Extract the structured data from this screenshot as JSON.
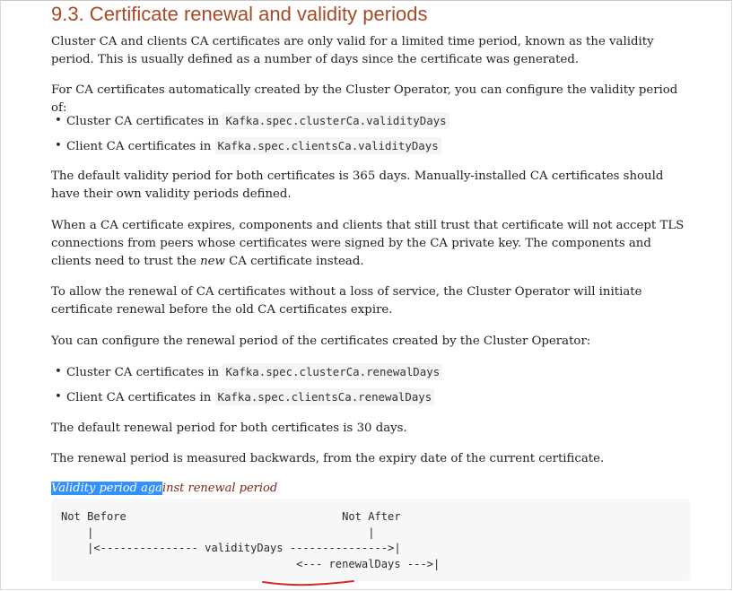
{
  "section": {
    "heading": "9.3. Certificate renewal and validity periods",
    "intro": "Cluster CA and clients CA certificates are only valid for a limited time period, known as the validity period. This is usually defined as a number of days since the certificate was generated.",
    "auto_created": "For CA certificates automatically created by the Cluster Operator, you can configure the validity period of:",
    "validity_items": [
      {
        "text": "Cluster CA certificates in ",
        "code": "Kafka.spec.clusterCa.validityDays"
      },
      {
        "text": "Client CA certificates in ",
        "code": "Kafka.spec.clientsCa.validityDays"
      }
    ],
    "default_validity": "The default validity period for both certificates is 365 days. Manually-installed CA certificates should have their own validity periods defined.",
    "expiry_part1": "When a CA certificate expires, components and clients that still trust that certificate will not accept TLS connections from peers whose certificates were signed by the CA private key. The components and clients need to trust the ",
    "expiry_emph": "new",
    "expiry_part2": " CA certificate instead.",
    "renewal_service": "To allow the renewal of CA certificates without a loss of service, the Cluster Operator will initiate certificate renewal before the old CA certificates expire.",
    "renewal_configure": "You can configure the renewal period of the certificates created by the Cluster Operator:",
    "renewal_items": [
      {
        "text": "Cluster CA certificates in ",
        "code": "Kafka.spec.clusterCa.renewalDays"
      },
      {
        "text": "Client CA certificates in ",
        "code": "Kafka.spec.clientsCa.renewalDays"
      }
    ],
    "default_renewal": "The default renewal period for both certificates is 30 days.",
    "measured": "The renewal period is measured backwards, from the expiry date of the current certificate.",
    "caption_selected": "Validity period aga",
    "caption_rest": "inst renewal period",
    "listing": "Not Before                                 Not After\n    |                                          |\n    |<--------------- validityDays --------------->|\n                                    <--- renewalDays --->|"
  },
  "colors": {
    "heading": "#a64927",
    "caption": "#7a2518",
    "selection": "#3390ff",
    "listing_background": "#f7f7f8",
    "annotation_ink": "#d42a2a"
  }
}
